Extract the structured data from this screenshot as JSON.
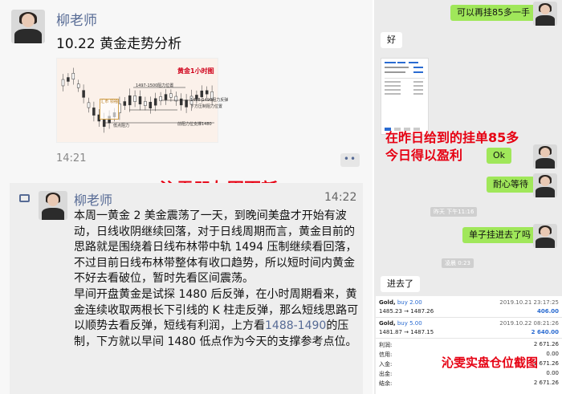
{
  "left": {
    "post": {
      "author": "柳老师",
      "title": "10.22 黄金走势分析",
      "time": "14:21",
      "more": "••"
    },
    "chart_image": {
      "title": "黄金1小时图",
      "labels": [
        "1497-1500阻力位置",
        "1488-1490阻力反弹",
        "下方压制阻力位置",
        "低点阻力",
        "前阻力位支撑1480"
      ],
      "stamp": "汇市 领袖"
    },
    "overlay_headline": "沁雯朋友圈更新",
    "repost": {
      "author": "柳老师",
      "time": "14:22",
      "para1": "本周一黄金 2 美金震荡了一天，到晚间美盘才开始有波动，日线收阴继续回落，对于日线周期而言，黄金目前的思路就是围绕着日线布林带中轨 1494 压制继续看回落，不过目前日线布林带整体有收口趋势，所以短时间内黄金不好去看破位，暂时先看区间震荡。",
      "para2_a": "早间开盘黄金是试探 1480 后反弹，在小时周期看来，黄金连续收取两根长下引线的 K 柱走反弹，那么短线思路可以顺势去看反弹，短线有利润，上方看",
      "para2_link": "1488-1490",
      "para2_b": "的压制，下方就以早间 1480 低点作为今天的支撑参考点位。"
    }
  },
  "right": {
    "chat": {
      "msg1": "可以再挂85多一手",
      "msg2": "好",
      "overlay_text_line1": "在昨日给到的挂单85多",
      "overlay_text_line2": "今日得以盈利",
      "msg3": "Ok",
      "msg4": "耐心等待",
      "sys_time1": "昨天 下午11:16",
      "msg5": "单子挂进去了吗",
      "sys_time2": "凌晨 0:23",
      "msg6": "进去了"
    },
    "positions": {
      "rows": [
        {
          "symbol": "Gold,",
          "side": "buy 2.00",
          "date": "2019.10.21 23:17:25",
          "prices": "1485.23 → 1487.26",
          "profit": "406.00"
        },
        {
          "symbol": "Gold,",
          "side": "buy 5.00",
          "date": "2019.10.22 08:21:26",
          "prices": "1481.87 → 1487.15",
          "profit": "2 640.00"
        }
      ],
      "summary": [
        {
          "label": "利润:",
          "value": "2 671.26"
        },
        {
          "label": "信用:",
          "value": "0.00"
        },
        {
          "label": "入金:",
          "value": "2 671.26"
        },
        {
          "label": "出金:",
          "value": "0.00"
        },
        {
          "label": "结余:",
          "value": "2 671.26"
        }
      ],
      "overlay_label": "沁雯实盘仓位截图"
    }
  }
}
